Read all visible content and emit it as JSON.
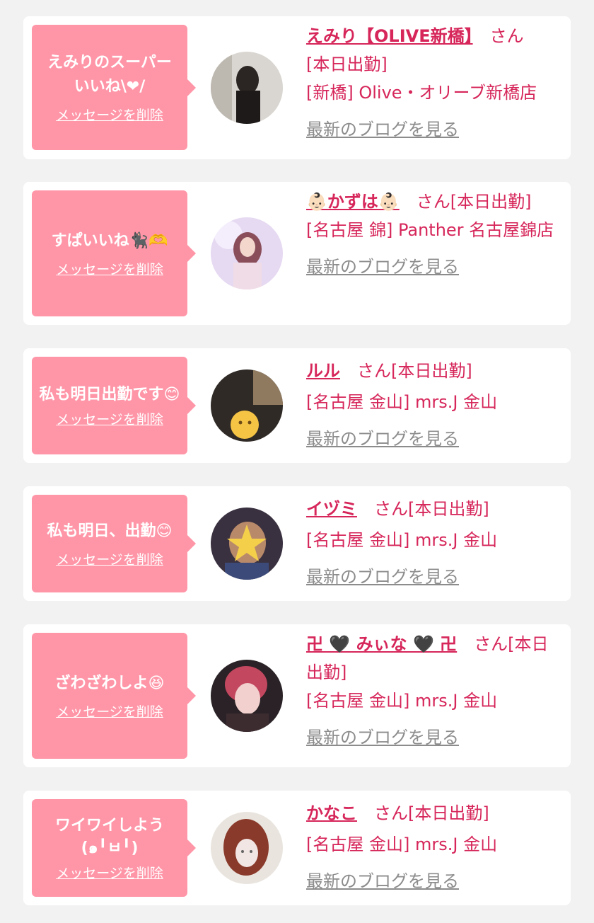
{
  "delete_label": "メッセージを削除",
  "blog_label": "最新のブログを見る",
  "cards": [
    {
      "message": "えみりのスーパー\nいいね\\❤/",
      "name": "えみり【OLIVE新橋】",
      "suffix": "さん",
      "status": "[本日出勤]",
      "shop": "[新橋] Olive・オリーブ新橋店"
    },
    {
      "message": "すぱいいね🐈‍⬛🫶",
      "name": "👶🏻かずは👶🏻",
      "suffix": "さん[本日出勤]",
      "status": "",
      "shop": "[名古屋 錦] Panther 名古屋錦店"
    },
    {
      "message": "私も明日出勤です😊",
      "name": "ルル",
      "suffix": "さん[本日出勤]",
      "status": "",
      "shop": "[名古屋 金山] mrs.J 金山"
    },
    {
      "message": "私も明日、出勤😊",
      "name": "イヅミ",
      "suffix": "さん[本日出勤]",
      "status": "",
      "shop": "[名古屋 金山] mrs.J 金山"
    },
    {
      "message": "ざわざわしよ😆",
      "name": "卍 🖤 みぃな 🖤 卍",
      "suffix": "さん[本日出勤]",
      "status": "",
      "shop": "[名古屋 金山] mrs.J 金山"
    },
    {
      "message": "ワイワイしよう\n(๑╹ㅂ╹)",
      "name": "かなこ",
      "suffix": "さん[本日出勤]",
      "status": "",
      "shop": "[名古屋 金山] mrs.J 金山"
    }
  ],
  "colors": {
    "bubble": "#ff96a8",
    "accent": "#d6265a",
    "muted": "#8c8c8c",
    "background": "#f2f2f2"
  }
}
